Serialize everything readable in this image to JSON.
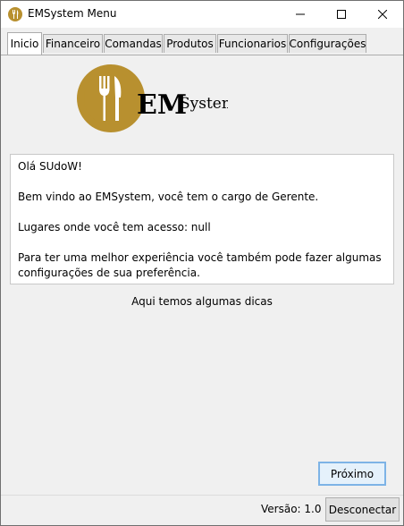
{
  "window": {
    "title": "EMSystem Menu",
    "icon": "fork-knife-icon"
  },
  "tabs": [
    {
      "label": "Inicio",
      "active": true
    },
    {
      "label": "Financeiro",
      "active": false
    },
    {
      "label": "Comandas",
      "active": false
    },
    {
      "label": "Produtos",
      "active": false
    },
    {
      "label": "Funcionarios",
      "active": false
    },
    {
      "label": "Configurações",
      "active": false
    }
  ],
  "logo": {
    "big_text": "EM",
    "small_text": "System",
    "accent_color": "#b8902f"
  },
  "message": {
    "lines": [
      "Olá SUdoW!",
      "Bem vindo ao EMSystem, você tem o cargo de Gerente.",
      "Lugares onde você tem acesso: null",
      "Para ter uma melhor experiência você também pode fazer algumas",
      "configurações de sua preferência."
    ]
  },
  "tips_label": "Aqui temos algumas dicas",
  "next_button": "Próximo",
  "version_label": "Versão: 1.0",
  "disconnect_button": "Desconectar"
}
